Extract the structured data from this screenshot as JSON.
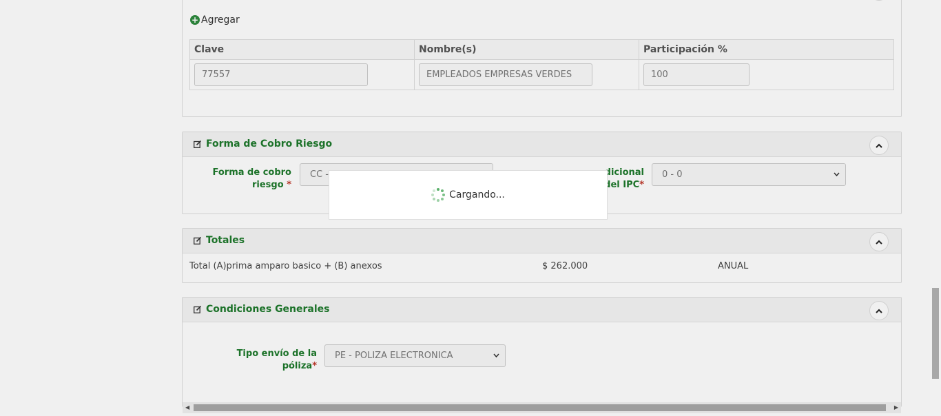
{
  "agregar_label": "Agregar",
  "table": {
    "headers": [
      "Clave",
      "Nombre(s)",
      "Participación %"
    ],
    "row": {
      "clave": "77557",
      "nombre": "EMPLEADOS EMPRESAS VERDES",
      "participacion": "100"
    }
  },
  "forma_cobro": {
    "title": "Forma de Cobro Riesgo",
    "label_cobro_line1": "Forma de cobro",
    "label_cobro_line2": "riesgo",
    "cobro_value": "CC -",
    "label_ipc_line1": "dicional",
    "label_ipc_line2": "del IPC",
    "ipc_value": "0 - 0",
    "required_mark": "*"
  },
  "totales": {
    "title": "Totales",
    "label": "Total (A)prima amparo basico + (B) anexos",
    "amount": "$ 262.000",
    "period": "ANUAL"
  },
  "condiciones": {
    "title": "Condiciones Generales",
    "label_line1": "Tipo envío de la",
    "label_line2": "póliza",
    "value": "PE - POLIZA ELECTRONICA",
    "required_mark": "*"
  },
  "loading_text": "Cargando...",
  "colors": {
    "accent": "#1e7a2c",
    "required": "#c0392b"
  }
}
